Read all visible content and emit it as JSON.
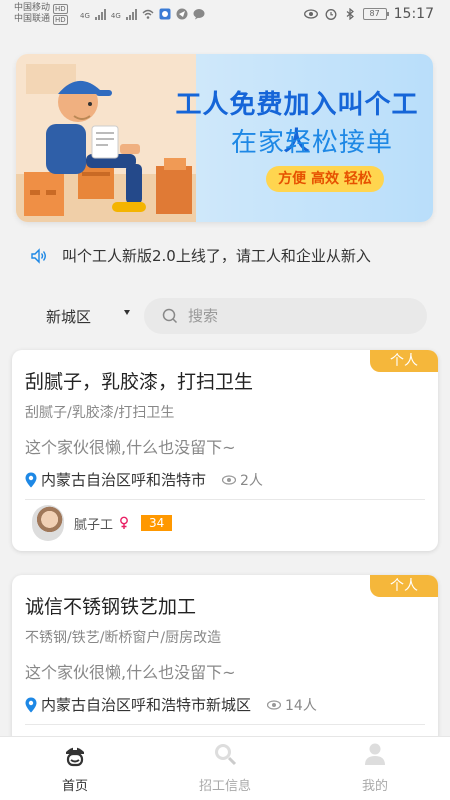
{
  "status_bar": {
    "carrier1": "中国移动",
    "carrier2": "中国联通",
    "hd": "HD",
    "network": "4G",
    "battery": "87",
    "time": "15:17"
  },
  "banner": {
    "title": "工人免费加入叫个工人",
    "subtitle": "在家轻松接单",
    "tagline": "方便 高效 轻松",
    "colors": {
      "title": "#1565d8",
      "tag_bg": "#ffd54f",
      "tag_text": "#e65100"
    }
  },
  "notice": {
    "icon": "speaker-icon",
    "text": "叫个工人新版2.0上线了，请工人和企业从新入"
  },
  "filter": {
    "district": "新城区",
    "search_placeholder": "搜索"
  },
  "cards": [
    {
      "badge": "个人",
      "title": "刮腻子，乳胶漆，打扫卫生",
      "tags": "刮腻子/乳胶漆/打扫卫生",
      "description": "这个家伙很懒,什么也没留下~",
      "location": "内蒙古自治区呼和浩特市",
      "views": "2人",
      "user": {
        "name": "腻子工",
        "gender": "female",
        "age": "34"
      }
    },
    {
      "badge": "个人",
      "title": "诚信不锈钢铁艺加工",
      "tags": "不锈钢/铁艺/断桥窗户/厨房改造",
      "description": "这个家伙很懒,什么也没留下~",
      "location": "内蒙古自治区呼和浩特市新城区",
      "views": "14人"
    }
  ],
  "bottom_nav": [
    {
      "label": "首页",
      "icon": "home-worker-icon",
      "active": true
    },
    {
      "label": "招工信息",
      "icon": "search-jobs-icon",
      "active": false
    },
    {
      "label": "我的",
      "icon": "profile-icon",
      "active": false
    }
  ],
  "colors": {
    "badge": "#f5b73b",
    "age_tag": "#ff9800",
    "location_pin": "#1e88e5"
  }
}
